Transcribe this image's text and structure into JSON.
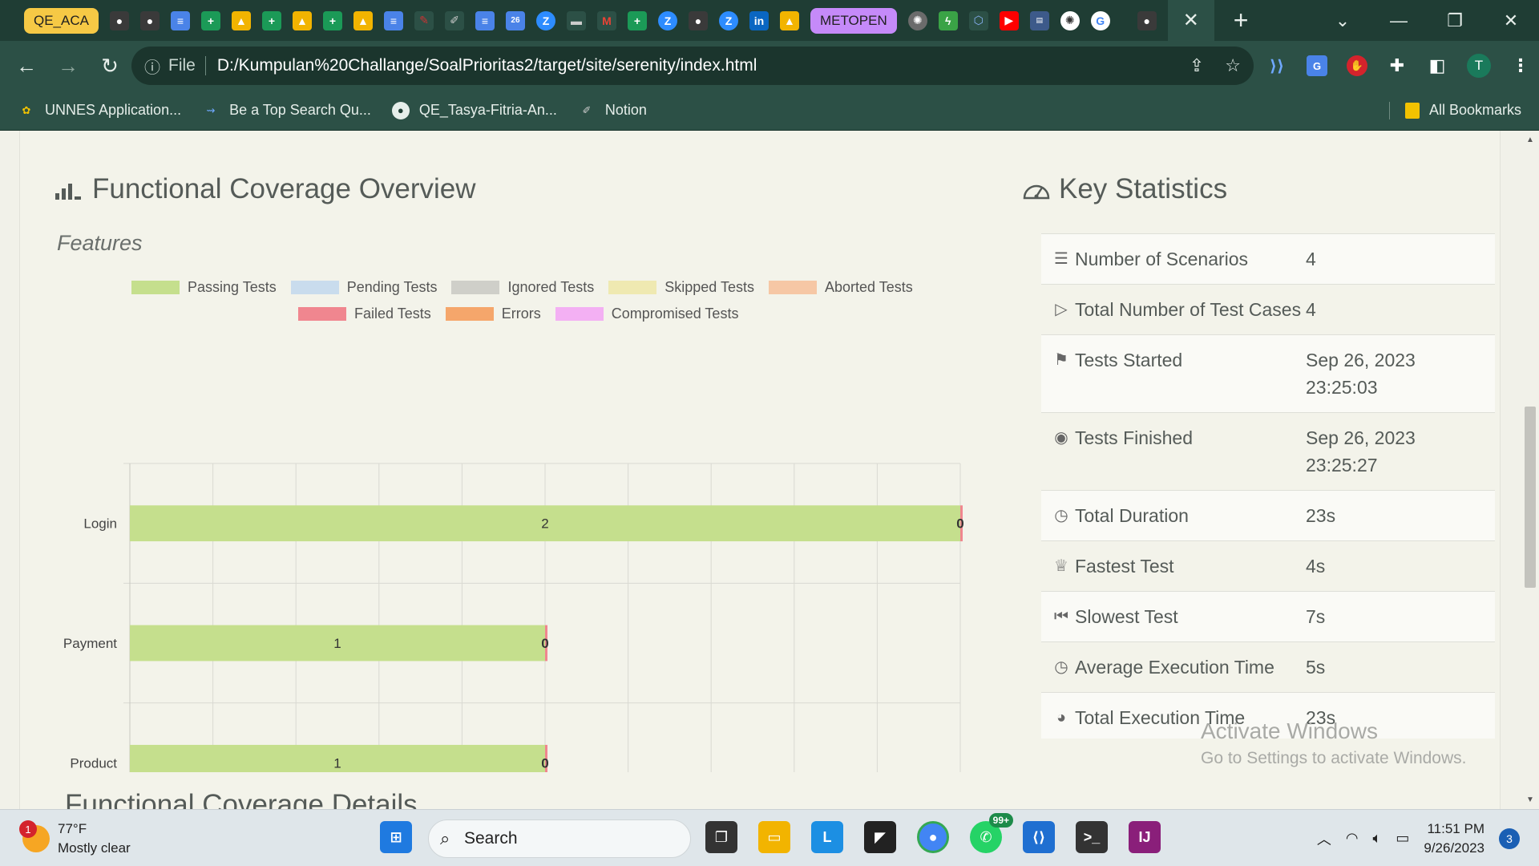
{
  "browser": {
    "tab_groups": [
      "QE_ACA",
      "METOPEN"
    ],
    "active_tab_close": "✕",
    "new_tab": "+",
    "scheme": "File",
    "url": "D:/Kumpulan%20Challange/SoalPrioritas2/target/site/serenity/index.html",
    "profile_initial": "T",
    "bookmarks": [
      "UNNES Application...",
      "Be a Top Search Qu...",
      "QE_Tasya-Fitria-An...",
      "Notion"
    ],
    "all_bookmarks": "All Bookmarks"
  },
  "coverage": {
    "title": "Functional Coverage Overview",
    "subtitle": "Features",
    "legend": [
      {
        "label": "Passing Tests",
        "color": "#c5df8d"
      },
      {
        "label": "Pending Tests",
        "color": "#c9dced"
      },
      {
        "label": "Ignored Tests",
        "color": "#cfcfc9"
      },
      {
        "label": "Skipped Tests",
        "color": "#efe9b1"
      },
      {
        "label": "Aborted Tests",
        "color": "#f6c7a5"
      },
      {
        "label": "Failed Tests",
        "color": "#f0868f"
      },
      {
        "label": "Errors",
        "color": "#f5a66b"
      },
      {
        "label": "Compromised Tests",
        "color": "#f3b0f3"
      }
    ]
  },
  "chart_data": {
    "type": "bar",
    "orientation": "horizontal",
    "stacked": true,
    "categories": [
      "Login",
      "Payment",
      "Product"
    ],
    "series": [
      {
        "name": "Passing Tests",
        "values": [
          2,
          1,
          1
        ]
      },
      {
        "name": "Failed Tests",
        "values": [
          0,
          0,
          0
        ]
      }
    ],
    "xlim": [
      0,
      2.0
    ],
    "xticks": [
      "0",
      "0.2",
      "0.4",
      "0.6",
      "0.8",
      "1.0",
      "1.2",
      "1.4",
      "1.6",
      "1.8",
      "2.0"
    ],
    "xtick_values": [
      0,
      0.2,
      0.4,
      0.6,
      0.8,
      1.0,
      1.2,
      1.4,
      1.6,
      1.8,
      2.0
    ],
    "grid": true,
    "legend": "top"
  },
  "stats": {
    "title": "Key Statistics",
    "rows": [
      {
        "label": "Number of Scenarios",
        "value": "4",
        "icon": "list-icon"
      },
      {
        "label": "Total Number of Test Cases",
        "value": "4",
        "icon": "play-icon"
      },
      {
        "label": "Tests Started",
        "value": "Sep 26, 2023 23:25:03",
        "icon": "flag-icon"
      },
      {
        "label": "Tests Finished",
        "value": "Sep 26, 2023 23:25:27",
        "icon": "stop-icon"
      },
      {
        "label": "Total Duration",
        "value": "23s",
        "icon": "stopwatch-icon"
      },
      {
        "label": "Fastest Test",
        "value": "4s",
        "icon": "trophy-icon"
      },
      {
        "label": "Slowest Test",
        "value": "7s",
        "icon": "step-back-icon"
      },
      {
        "label": "Average Execution Time",
        "value": "5s",
        "icon": "stopwatch-icon"
      },
      {
        "label": "Total Execution Time",
        "value": "23s",
        "icon": "stopwatch-filled-icon"
      }
    ]
  },
  "details_title": "Functional Coverage Details",
  "watermark": {
    "line1": "Activate Windows",
    "line2": "Go to Settings to activate Windows."
  },
  "taskbar": {
    "temp": "77°F",
    "weather": "Mostly clear",
    "weather_badge": "1",
    "search": "Search",
    "whatsapp_badge": "99+",
    "time": "11:51 PM",
    "date": "9/26/2023",
    "notifications": "3"
  }
}
